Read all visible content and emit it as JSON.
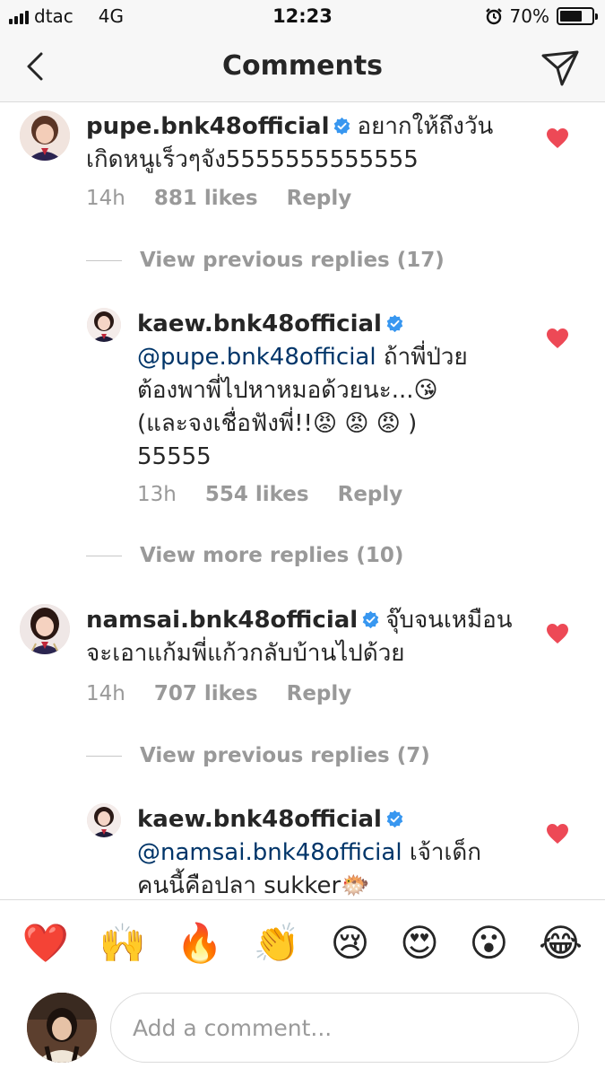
{
  "status_bar": {
    "carrier": "dtac",
    "network": "4G",
    "time": "12:23",
    "battery": "70%",
    "battery_level": 0.7
  },
  "nav": {
    "title": "Comments",
    "back_icon": "chevron-left-icon",
    "send_icon": "send-icon"
  },
  "comments": [
    {
      "username": "pupe.bnk48official",
      "verified": true,
      "text_lines": [
        "อยากให้ถึงวัน",
        "เกิดหนูเร็วๆจัง5555555555555"
      ],
      "time": "14h",
      "likes": "881 likes",
      "reply": "Reply",
      "liked": true
    },
    {
      "username": "kaew.bnk48official",
      "verified": true,
      "is_reply": true,
      "mention": "@pupe.bnk48official",
      "text_lines": [
        "ถ้าพี่ป่วย",
        "ต้องพาพี่ไปหาหมอด้วยนะ...😘",
        "(และจงเชื่อฟังพี่!!😡 😡 😡 )",
        "55555"
      ],
      "time": "13h",
      "likes": "554 likes",
      "reply": "Reply",
      "liked": true
    },
    {
      "username": "namsai.bnk48official",
      "verified": true,
      "text_lines": [
        "จุ๊บจนเหมือน",
        "จะเอาแก้มพี่แก้วกลับบ้านไปด้วย"
      ],
      "time": "14h",
      "likes": "707 likes",
      "reply": "Reply",
      "liked": true
    },
    {
      "username": "kaew.bnk48official",
      "verified": true,
      "is_reply": true,
      "mention": "@namsai.bnk48official",
      "text_lines": [
        "เจ้าเด็ก",
        "คนนี้คือปลา sukker🐡"
      ],
      "liked": true
    }
  ],
  "view_replies": [
    "View previous replies (17)",
    "View more replies (10)",
    "View previous replies (7)"
  ],
  "emoji_bar": [
    "❤️",
    "🙌",
    "🔥",
    "👏",
    "😢",
    "😍",
    "😮",
    "😂"
  ],
  "input": {
    "placeholder": "Add a comment..."
  },
  "colors": {
    "heart": "#ed4956",
    "verified": "#3897f0",
    "mention": "#003569",
    "meta": "#999999"
  }
}
